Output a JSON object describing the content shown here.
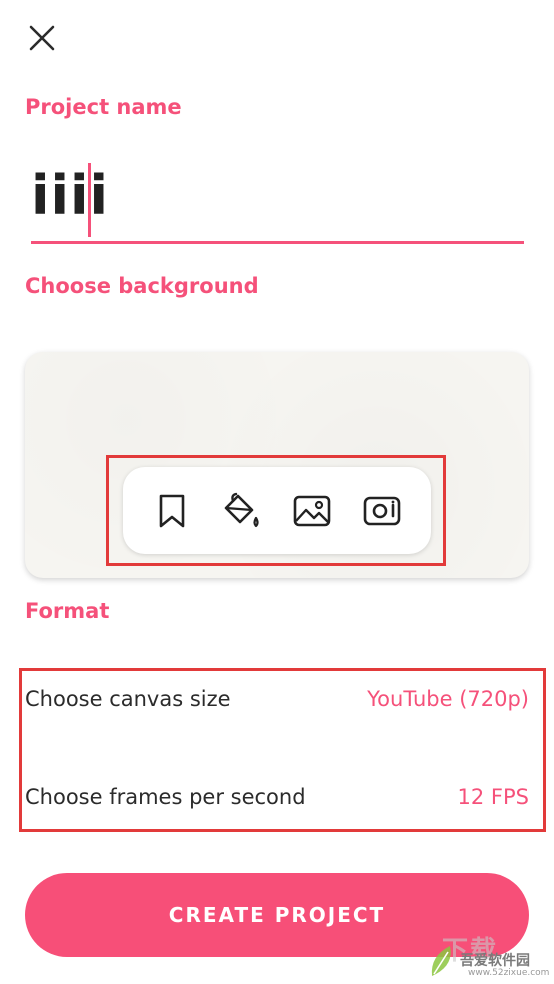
{
  "header": {
    "close_icon": "close-icon"
  },
  "project": {
    "label": "Project name",
    "value": "iiii"
  },
  "background": {
    "label": "Choose background",
    "tools": [
      "bookmark-icon",
      "paint-bucket-icon",
      "image-icon",
      "camera-icon"
    ]
  },
  "format": {
    "label": "Format",
    "canvas": {
      "label": "Choose canvas size",
      "value": "YouTube (720p)"
    },
    "fps": {
      "label": "Choose frames per second",
      "value": "12 FPS"
    }
  },
  "actions": {
    "create_label": "CREATE PROJECT"
  },
  "watermark": {
    "title": "吾爱软件园",
    "url": "www.52zixue.com",
    "overlay": "下载"
  },
  "colors": {
    "accent": "#f5517a",
    "button": "#f74f78",
    "highlight": "#e23a3a",
    "text": "#2b2b2b"
  }
}
